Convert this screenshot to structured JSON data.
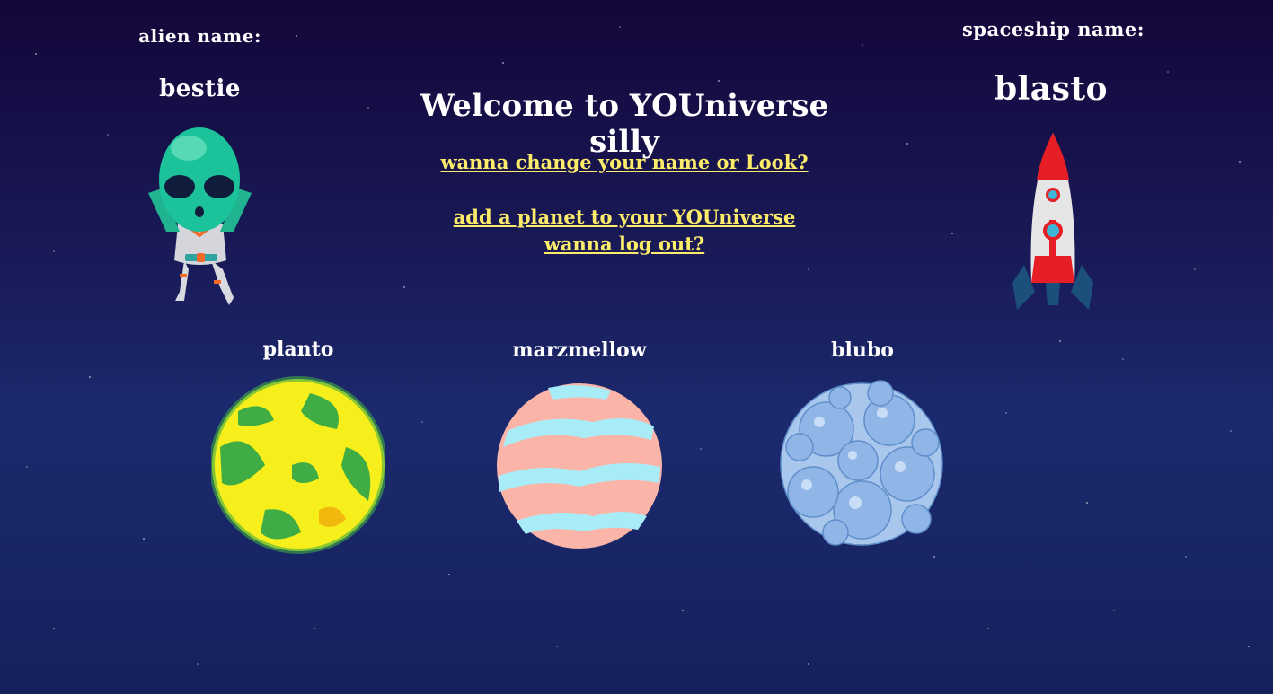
{
  "alien": {
    "label": "alien name:",
    "name": "bestie"
  },
  "spaceship": {
    "label": "spaceship name:",
    "name": "blasto"
  },
  "title": "Welcome to YOUniverse silly",
  "links": {
    "change": "wanna change your name or Look?",
    "add_planet": "add a planet to your YOUniverse",
    "logout": "wanna log out?"
  },
  "planets": [
    {
      "name": "planto"
    },
    {
      "name": "marzmellow"
    },
    {
      "name": "blubo"
    }
  ],
  "colors": {
    "link": "#fcec6a",
    "background": "#1a1f5e"
  }
}
